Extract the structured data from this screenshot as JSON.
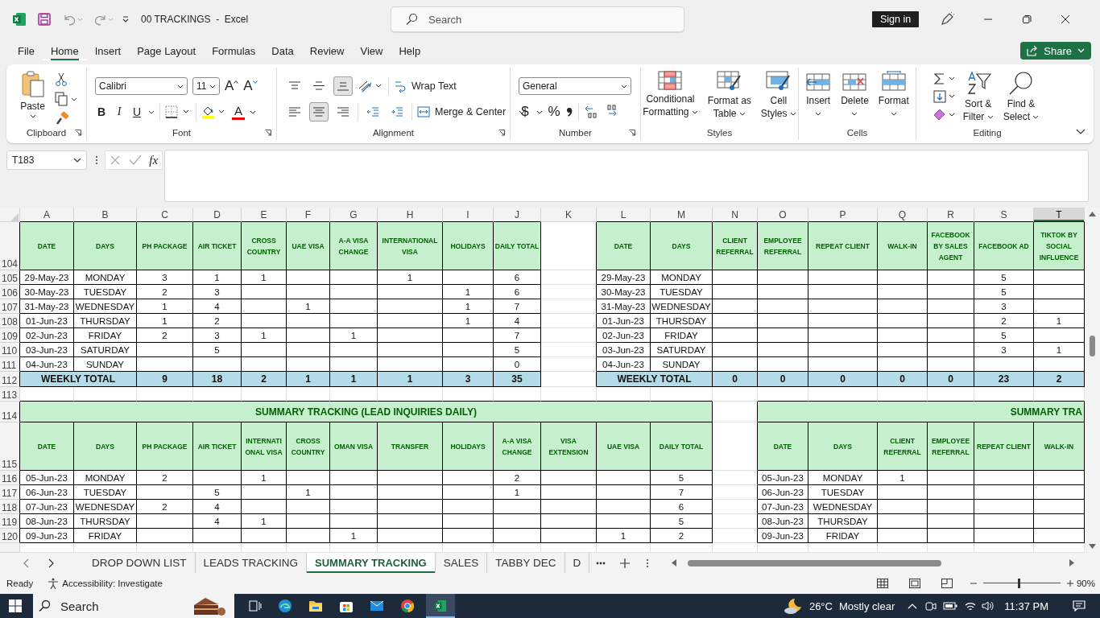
{
  "title_bar": {
    "title": "00 TRACKINGS  -  Excel",
    "search": {
      "placeholder": "Search"
    },
    "sign_in": "Sign in"
  },
  "menu": [
    {
      "label": "File",
      "selected": false
    },
    {
      "label": "Home",
      "selected": true
    },
    {
      "label": "Insert",
      "selected": false
    },
    {
      "label": "Page Layout",
      "selected": false
    },
    {
      "label": "Formulas",
      "selected": false
    },
    {
      "label": "Data",
      "selected": false
    },
    {
      "label": "Review",
      "selected": false
    },
    {
      "label": "View",
      "selected": false
    },
    {
      "label": "Help",
      "selected": false
    }
  ],
  "share": "Share",
  "ribbon": {
    "clipboard": {
      "label": "Clipboard",
      "paste": "Paste"
    },
    "font": {
      "label": "Font",
      "family": "Calibri",
      "size": "11",
      "grow": "A",
      "shrink": "A",
      "bold": "B",
      "italic": "I",
      "underline": "U",
      "color_letter": "A"
    },
    "alignment": {
      "label": "Alignment",
      "buttons": [
        {
          "kind": "top",
          "selected": false
        },
        {
          "kind": "middle",
          "selected": false
        },
        {
          "kind": "bottom",
          "selected": true
        },
        {
          "kind": "left",
          "selected": false
        },
        {
          "kind": "center",
          "selected": true
        },
        {
          "kind": "right",
          "selected": false
        },
        {
          "kind": "outdent",
          "selected": false
        },
        {
          "kind": "indent",
          "selected": false
        }
      ],
      "wrap": "Wrap Text",
      "merge": "Merge & Center"
    },
    "number": {
      "label": "Number",
      "format": "General",
      "currency": "$",
      "percent": "%"
    },
    "styles": {
      "label": "Styles",
      "buttons": [
        [
          "Conditional",
          "Formatting"
        ],
        [
          "Format as",
          "Table"
        ],
        [
          "Cell",
          "Styles"
        ]
      ]
    },
    "cells": {
      "label": "Cells",
      "buttons": [
        "Insert",
        "Delete",
        "Format"
      ]
    },
    "editing": {
      "label": "Editing",
      "buttons": [
        [
          "Sort &",
          "Filter"
        ],
        [
          "Find &",
          "Select"
        ]
      ]
    }
  },
  "formula_bar": {
    "name_box": "T183",
    "fx": "fx"
  },
  "sheet": {
    "columns": [
      {
        "label": "A",
        "selected": false
      },
      {
        "label": "B",
        "selected": false
      },
      {
        "label": "C",
        "selected": false
      },
      {
        "label": "D",
        "selected": false
      },
      {
        "label": "E",
        "selected": false
      },
      {
        "label": "F",
        "selected": false
      },
      {
        "label": "G",
        "selected": false
      },
      {
        "label": "H",
        "selected": false
      },
      {
        "label": "I",
        "selected": false
      },
      {
        "label": "J",
        "selected": false
      },
      {
        "label": "K",
        "selected": false
      },
      {
        "label": "L",
        "selected": false
      },
      {
        "label": "M",
        "selected": false
      },
      {
        "label": "N",
        "selected": false
      },
      {
        "label": "O",
        "selected": false
      },
      {
        "label": "P",
        "selected": false
      },
      {
        "label": "Q",
        "selected": false
      },
      {
        "label": "R",
        "selected": false
      },
      {
        "label": "S",
        "selected": false
      },
      {
        "label": "T",
        "selected": true
      }
    ],
    "row_numbers": [
      "104",
      "105",
      "106",
      "107",
      "108",
      "109",
      "110",
      "111",
      "112",
      "113",
      "114",
      "115",
      "116",
      "117",
      "118",
      "119",
      "120"
    ],
    "sections": [
      {
        "tables": [
          {
            "headers": [
              "DATE",
              "DAYS",
              "PH PACKAGE",
              "AIR TICKET",
              "CROSS COUNTRY",
              "UAE VISA",
              "A-A VISA CHANGE",
              "INTERNATIONAL VISA",
              "HOLIDAYS",
              "DAILY TOTAL"
            ],
            "rows": [
              [
                "29-May-23",
                "MONDAY",
                "3",
                "1",
                "1",
                null,
                null,
                "1",
                null,
                "6"
              ],
              [
                "30-May-23",
                "TUESDAY",
                "2",
                "3",
                null,
                null,
                null,
                null,
                "1",
                "6"
              ],
              [
                "31-May-23",
                "WEDNESDAY",
                "1",
                "4",
                null,
                "1",
                null,
                null,
                "1",
                "7"
              ],
              [
                "01-Jun-23",
                "THURSDAY",
                "1",
                "2",
                null,
                null,
                null,
                null,
                "1",
                "4"
              ],
              [
                "02-Jun-23",
                "FRIDAY",
                "2",
                "3",
                "1",
                null,
                "1",
                null,
                null,
                "7"
              ],
              [
                "03-Jun-23",
                "SATURDAY",
                null,
                "5",
                null,
                null,
                null,
                null,
                null,
                "5"
              ],
              [
                "04-Jun-23",
                "SUNDAY",
                null,
                null,
                null,
                null,
                null,
                null,
                null,
                "0"
              ]
            ],
            "total": [
              "WEEKLY TOTAL",
              "9",
              "18",
              "2",
              "1",
              "1",
              "1",
              "3",
              "35"
            ]
          },
          {
            "headers": [
              "DATE",
              "DAYS",
              "CLIENT REFERRAL",
              "EMPLOYEE REFERRAL",
              "REPEAT CLIENT",
              "WALK-IN",
              "FACEBOOK BY SALES AGENT",
              "FACEBOOK AD",
              "TIKTOK BY SOCIAL INFLUENCE"
            ],
            "rows": [
              [
                "29-May-23",
                "MONDAY",
                null,
                null,
                null,
                null,
                null,
                "5",
                null
              ],
              [
                "30-May-23",
                "TUESDAY",
                null,
                null,
                null,
                null,
                null,
                "5",
                null
              ],
              [
                "31-May-23",
                "WEDNESDAY",
                null,
                null,
                null,
                null,
                null,
                "3",
                null
              ],
              [
                "01-Jun-23",
                "THURSDAY",
                null,
                null,
                null,
                null,
                null,
                "2",
                "1"
              ],
              [
                "02-Jun-23",
                "FRIDAY",
                null,
                null,
                null,
                null,
                null,
                "5",
                null
              ],
              [
                "03-Jun-23",
                "SATURDAY",
                null,
                null,
                null,
                null,
                null,
                "3",
                "1"
              ],
              [
                "04-Jun-23",
                "SUNDAY",
                null,
                null,
                null,
                null,
                null,
                null,
                null
              ]
            ],
            "total": [
              "WEEKLY TOTAL",
              "0",
              "0",
              "0",
              "0",
              "0",
              "23",
              "2"
            ]
          }
        ]
      },
      {
        "tables": [
          {
            "title": "SUMMARY TRACKING (LEAD INQUIRIES DAILY)",
            "title_cut": false,
            "headers": [
              "DATE",
              "DAYS",
              "PH PACKAGE",
              "AIR TICKET",
              "INTERNATI ONAL VISA",
              "CROSS COUNTRY",
              "OMAN VISA",
              "TRANSFER",
              "HOLIDAYS",
              "A-A VISA CHANGE",
              "VISA EXTENSION",
              "UAE VISA",
              "DAILY TOTAL"
            ],
            "rows": [
              [
                "05-Jun-23",
                "MONDAY",
                "2",
                null,
                "1",
                null,
                null,
                null,
                null,
                "2",
                null,
                null,
                "5"
              ],
              [
                "06-Jun-23",
                "TUESDAY",
                null,
                "5",
                null,
                "1",
                null,
                null,
                null,
                "1",
                null,
                null,
                "7"
              ],
              [
                "07-Jun-23",
                "WEDNESDAY",
                "2",
                "4",
                null,
                null,
                null,
                null,
                null,
                null,
                null,
                null,
                "6"
              ],
              [
                "08-Jun-23",
                "THURSDAY",
                null,
                "4",
                "1",
                null,
                null,
                null,
                null,
                null,
                null,
                null,
                "5"
              ],
              [
                "09-Jun-23",
                "FRIDAY",
                null,
                null,
                null,
                null,
                "1",
                null,
                null,
                null,
                null,
                "1",
                "2"
              ]
            ]
          },
          {
            "title": "SUMMARY TRA",
            "title_cut": true,
            "headers": [
              "DATE",
              "DAYS",
              "CLIENT REFERRAL",
              "EMPLOYEE REFERRAL",
              "REPEAT CLIENT",
              "WALK-IN"
            ],
            "rows": [
              [
                "05-Jun-23",
                "MONDAY",
                "1",
                null,
                null,
                null
              ],
              [
                "06-Jun-23",
                "TUESDAY",
                null,
                null,
                null,
                null
              ],
              [
                "07-Jun-23",
                "WEDNESDAY",
                null,
                null,
                null,
                null
              ],
              [
                "08-Jun-23",
                "THURSDAY",
                null,
                null,
                null,
                null
              ],
              [
                "09-Jun-23",
                "FRIDAY",
                null,
                null,
                null,
                null
              ]
            ]
          }
        ]
      }
    ]
  },
  "sheet_tabs": [
    {
      "label": "DROP DOWN LIST",
      "selected": false
    },
    {
      "label": "LEADS TRACKING",
      "selected": false
    },
    {
      "label": "SUMMARY TRACKING",
      "selected": true
    },
    {
      "label": "SALES",
      "selected": false
    },
    {
      "label": "TABBY DEC",
      "selected": false
    },
    {
      "label": "D",
      "selected": false
    }
  ],
  "status_bar": {
    "mode": "Ready",
    "accessibility": "Accessibility: Investigate",
    "zoom": {
      "level": 0.46,
      "reading": "90%"
    }
  },
  "taskbar": {
    "search": {
      "placeholder": "Search"
    },
    "temperature": "26°C",
    "weather": "Mostly clear",
    "time": "11:37 PM"
  }
}
